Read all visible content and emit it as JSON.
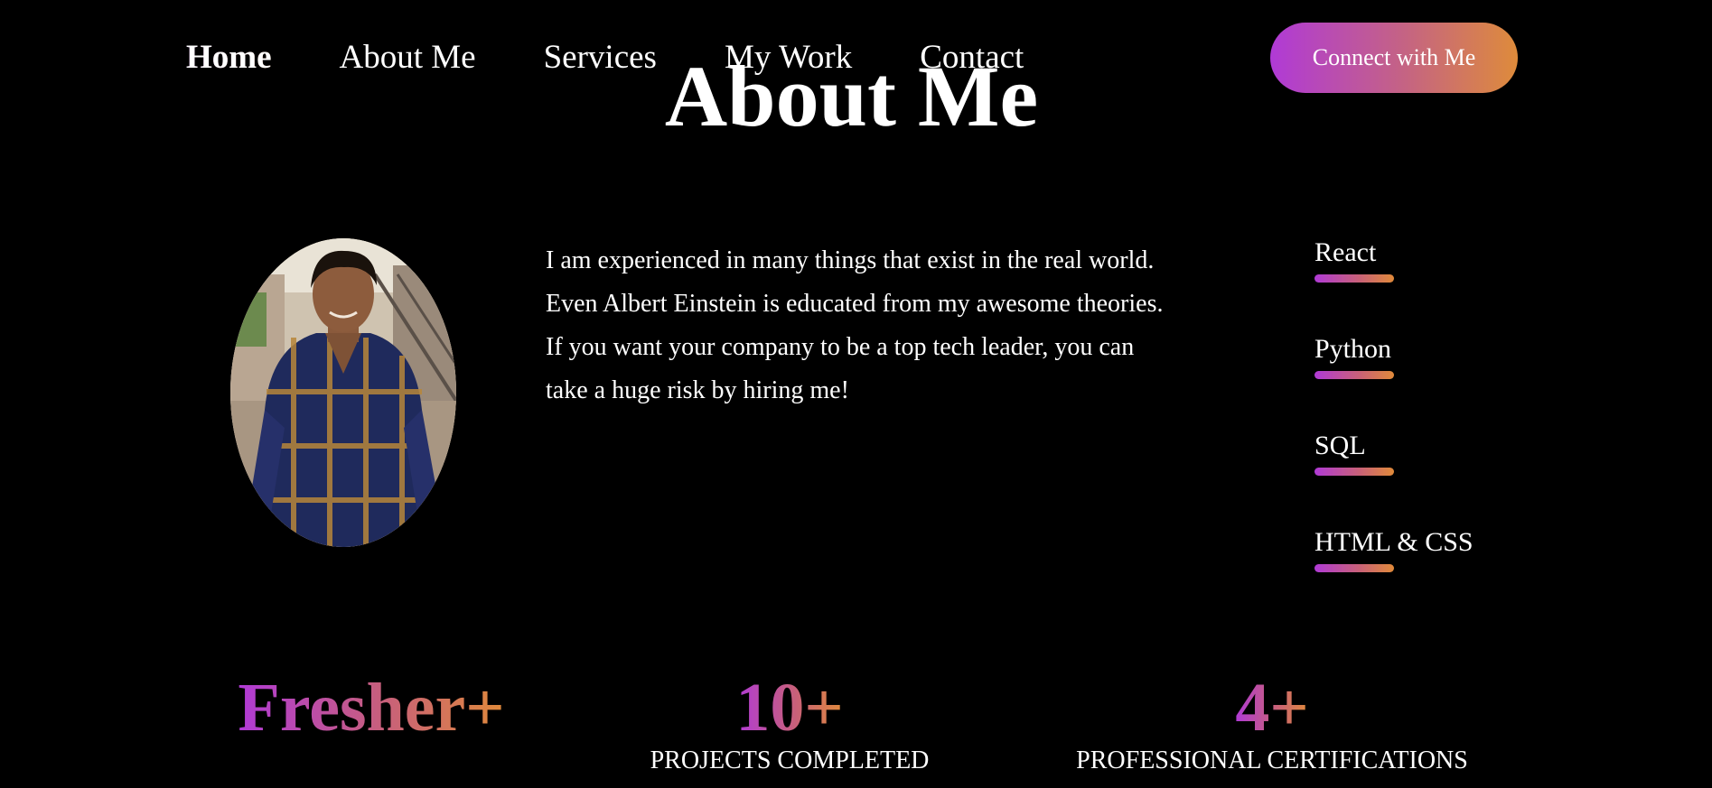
{
  "nav": {
    "items": [
      {
        "label": "Home",
        "active": true
      },
      {
        "label": "About Me",
        "active": false
      },
      {
        "label": "Services",
        "active": false
      },
      {
        "label": "My Work",
        "active": false
      },
      {
        "label": "Contact",
        "active": false
      }
    ],
    "cta_label": "Connect with Me"
  },
  "about": {
    "title": "About Me",
    "bio_lines": [
      "I am experienced in many things that exist in the real world.",
      "Even Albert Einstein is educated from my awesome theories.",
      "If you want your company to be a top tech leader, you can",
      "take a huge risk by hiring me!"
    ]
  },
  "skills": [
    {
      "label": "React"
    },
    {
      "label": "Python"
    },
    {
      "label": "SQL"
    },
    {
      "label": "HTML & CSS"
    }
  ],
  "stats": [
    {
      "value": "Fresher+",
      "label": ""
    },
    {
      "value": "10+",
      "label": "PROJECTS COMPLETED"
    },
    {
      "value": "4+",
      "label": "PROFESSIONAL CERTIFICATIONS"
    }
  ],
  "colors": {
    "background": "#000000",
    "accent_start": "#b03ad6",
    "accent_mid": "#c8607a",
    "accent_end": "#e08a3a",
    "text": "#ffffff"
  }
}
